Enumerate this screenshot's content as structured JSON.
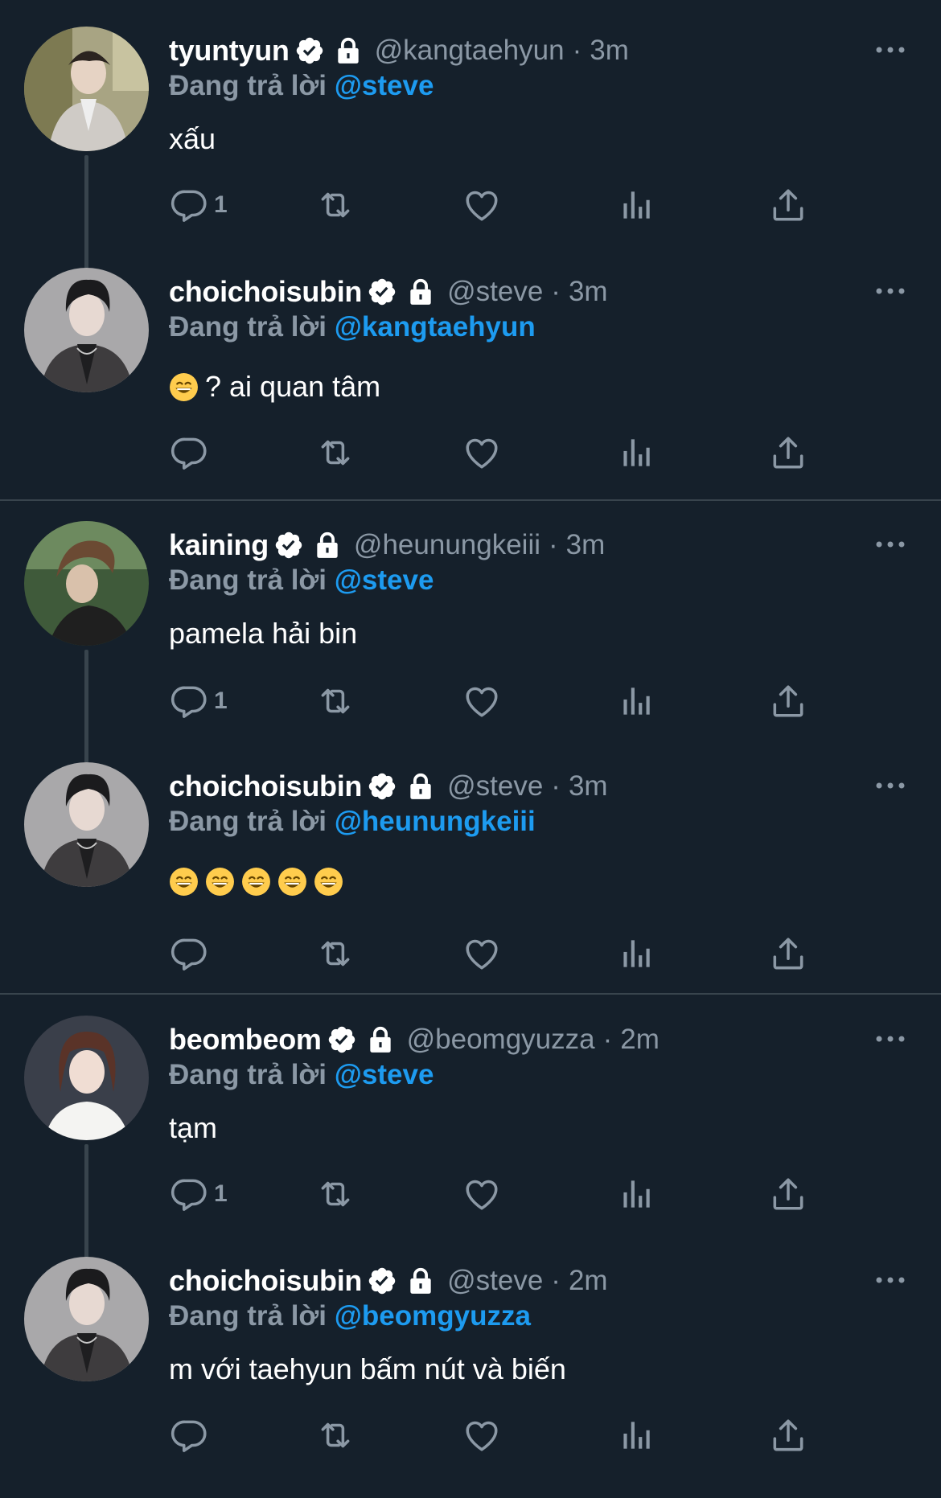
{
  "colors": {
    "background": "#15202b",
    "muted": "#8b98a5",
    "accent": "#1d9bf0",
    "line": "#38444d",
    "text": "#ffffff"
  },
  "reply_label": "Đang trả lời",
  "tweets": [
    {
      "display_name": "tyuntyun",
      "handle": "@kangtaehyun",
      "separator": "·",
      "time": "3m",
      "reply_to": "@steve",
      "text": "xấu",
      "reply_count": "1",
      "avatar": "avatar-tyuntyun"
    },
    {
      "display_name": "choichoisubin",
      "handle": "@steve",
      "separator": "·",
      "time": "3m",
      "reply_to": "@kangtaehyun",
      "text": "? ai quan tâm",
      "emoji": "grinning-face-icon",
      "reply_count": "",
      "avatar": "avatar-choichoisubin"
    },
    {
      "display_name": "kaining",
      "handle": "@heunungkeiii",
      "separator": "·",
      "time": "3m",
      "reply_to": "@steve",
      "text": "pamela hải bin",
      "reply_count": "1",
      "avatar": "avatar-kaining"
    },
    {
      "display_name": "choichoisubin",
      "handle": "@steve",
      "separator": "·",
      "time": "3m",
      "reply_to": "@heunungkeiii",
      "text": "",
      "emoji": "grinning-face-icon",
      "emoji_count": 5,
      "reply_count": "",
      "avatar": "avatar-choichoisubin"
    },
    {
      "display_name": "beombeom",
      "handle": "@beomgyuzza",
      "separator": "·",
      "time": "2m",
      "reply_to": "@steve",
      "text": "tạm",
      "reply_count": "1",
      "avatar": "avatar-beombeom"
    },
    {
      "display_name": "choichoisubin",
      "handle": "@steve",
      "separator": "·",
      "time": "2m",
      "reply_to": "@beomgyuzza",
      "text": "m với taehyun bấm nút và biến",
      "reply_count": "",
      "avatar": "avatar-choichoisubin"
    }
  ],
  "icons": {
    "verified": "verified-badge-icon",
    "protected": "lock-icon",
    "more": "more-icon",
    "reply": "reply-icon",
    "retweet": "retweet-icon",
    "like": "like-icon",
    "views": "views-icon",
    "share": "share-icon"
  }
}
